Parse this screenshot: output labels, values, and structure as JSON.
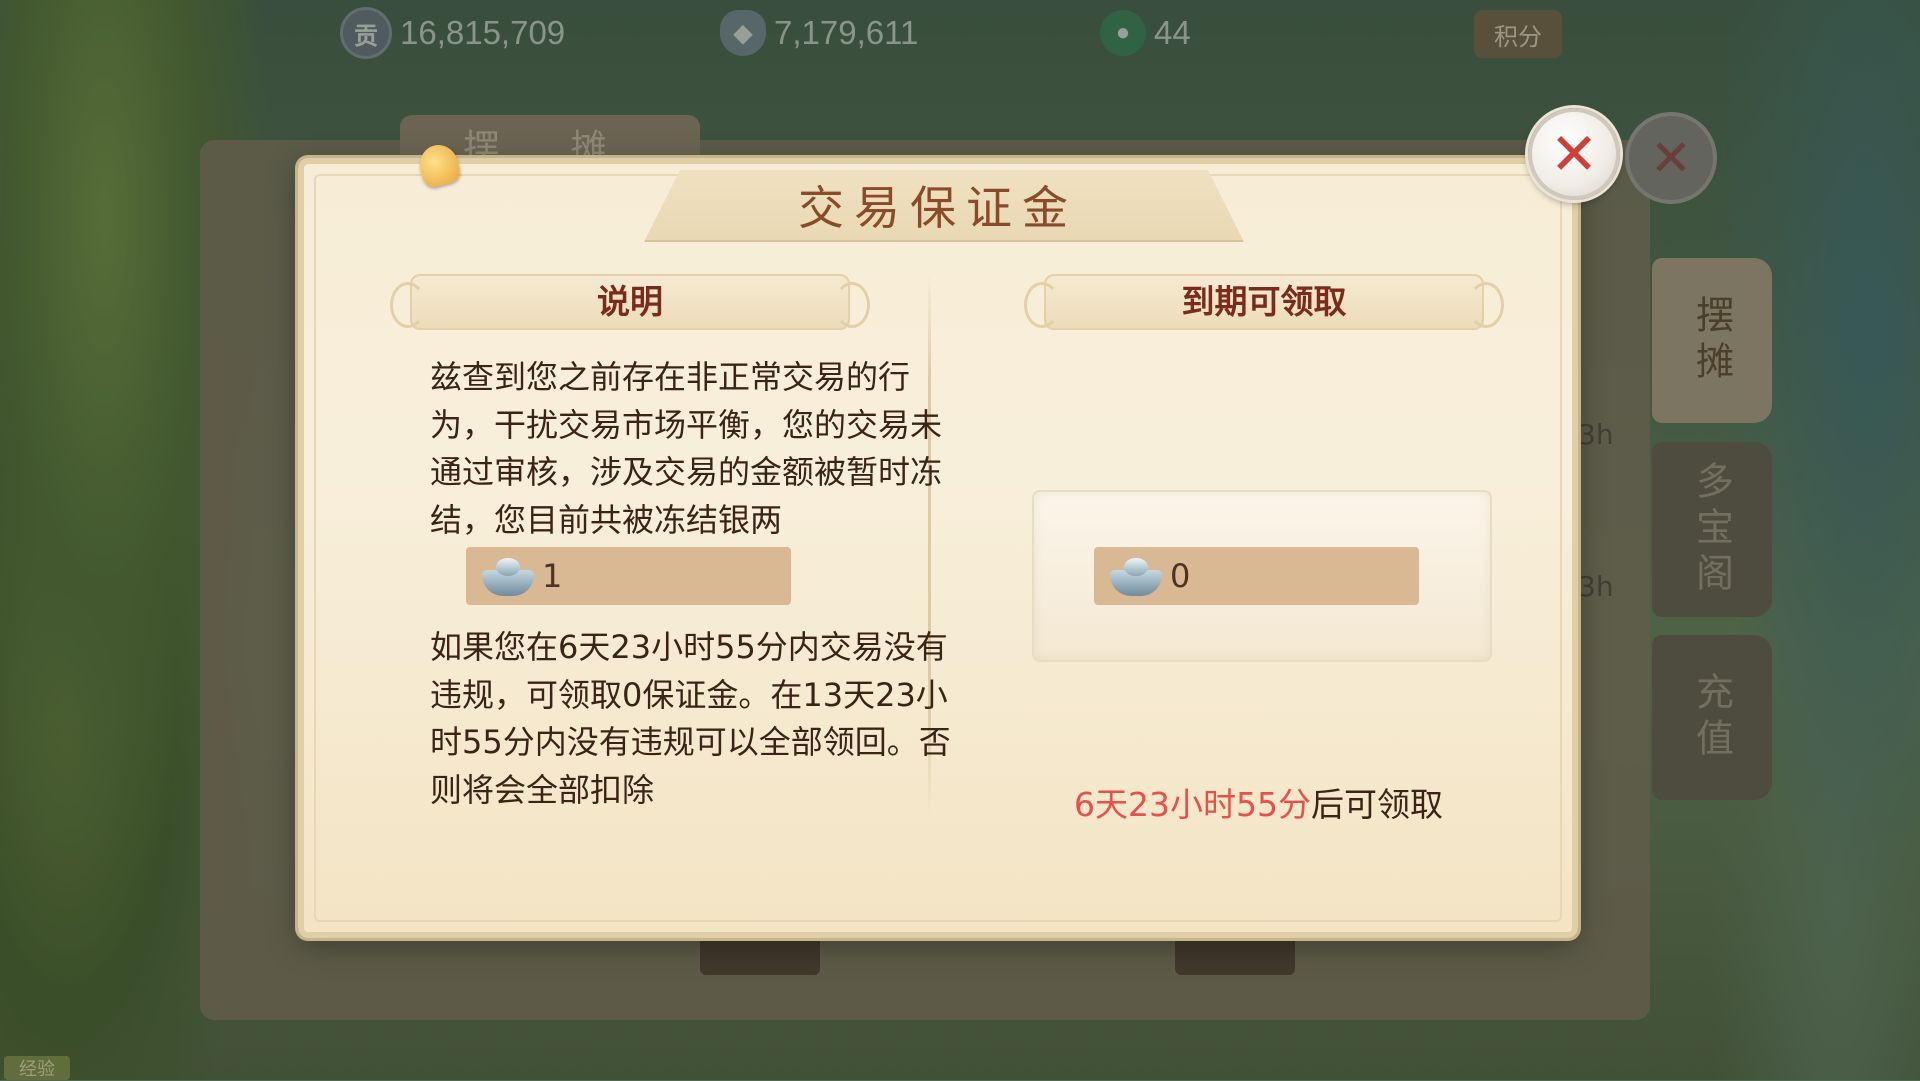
{
  "resources": [
    {
      "icon": "贡",
      "value": "16,815,709"
    },
    {
      "icon": "",
      "value": "7,179,611"
    },
    {
      "icon": "",
      "value": "44"
    }
  ],
  "jifen_label": "积分",
  "back_panel": {
    "tab": "摆 摊",
    "side_tabs": [
      "摆摊",
      "多宝阁",
      "充值"
    ],
    "fragment_text": "3h",
    "exp_label": "经验"
  },
  "dialog": {
    "title": "交易保证金",
    "left": {
      "header": "说明",
      "para1": "兹查到您之前存在非正常交易的行为，干扰交易市场平衡，您的交易未通过审核，涉及交易的金额被暂时冻结，您目前共被冻结银两",
      "frozen_amount": "1",
      "para2": "如果您在6天23小时55分内交易没有违规，可领取0保证金。在13天23小时55分内没有违规可以全部领回。否则将会全部扣除"
    },
    "right": {
      "header": "到期可领取",
      "claimable_amount": "0",
      "claim_time": "6天23小时55分",
      "claim_suffix": "后可领取"
    },
    "close_symbol": "✕"
  }
}
